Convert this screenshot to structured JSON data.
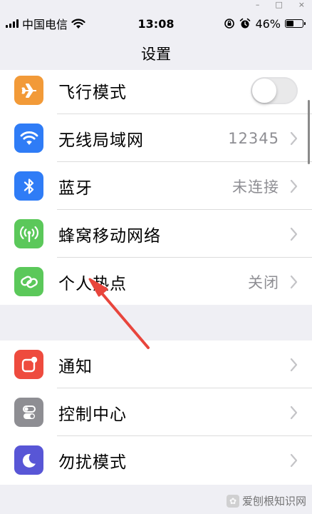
{
  "window_controls": [
    "–",
    "□",
    "×"
  ],
  "status_bar": {
    "carrier": "中国电信",
    "time": "13:08",
    "battery_text": "46%",
    "battery_level": 0.46
  },
  "nav": {
    "title": "设置"
  },
  "group1": [
    {
      "label": "飞行模式",
      "icon": "airplane-icon",
      "color": "#f29a38",
      "control": "toggle",
      "toggle_on": false
    },
    {
      "label": "无线局域网",
      "icon": "wifi-icon",
      "color": "#2f7cf6",
      "value": "12345",
      "control": "chevron"
    },
    {
      "label": "蓝牙",
      "icon": "bluetooth-icon",
      "color": "#2f7cf6",
      "value": "未连接",
      "control": "chevron"
    },
    {
      "label": "蜂窝移动网络",
      "icon": "cellular-icon",
      "color": "#5bc85a",
      "control": "chevron"
    },
    {
      "label": "个人热点",
      "icon": "hotspot-icon",
      "color": "#5bc85a",
      "value": "关闭",
      "control": "chevron"
    }
  ],
  "group2": [
    {
      "label": "通知",
      "icon": "notifications-icon",
      "color": "#ee4b3e",
      "control": "chevron"
    },
    {
      "label": "控制中心",
      "icon": "control-center-icon",
      "color": "#8e8e93",
      "control": "chevron"
    },
    {
      "label": "勿扰模式",
      "icon": "moon-icon",
      "color": "#5856d6",
      "control": "chevron"
    }
  ],
  "watermark": {
    "text": "爱刨根知识网"
  },
  "annotation_color": "#e8453c"
}
